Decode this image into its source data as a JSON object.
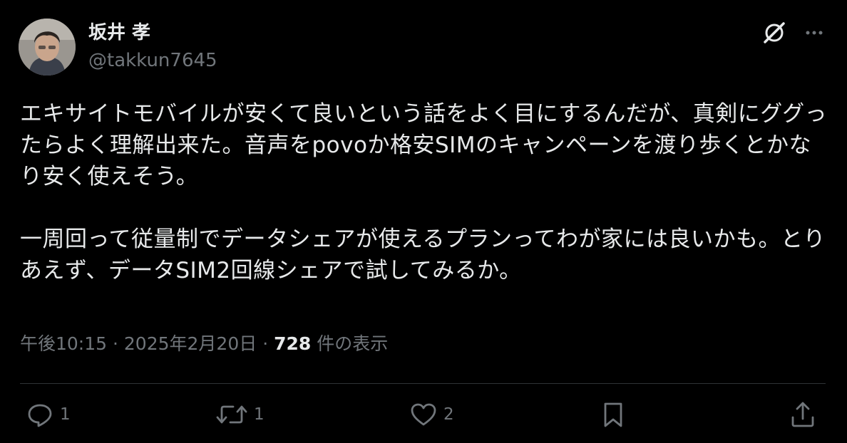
{
  "author": {
    "display_name": "坂井 孝",
    "handle": "@takkun7645"
  },
  "post": {
    "text": "エキサイトモバイルが安くて良いという話をよく目にするんだが、真剣にググったらよく理解出来た。音声をpovoか格安SIMのキャンペーンを渡り歩くとかなり安く使えそう。\n\n一周回って従量制でデータシェアが使えるプランってわが家には良いかも。とりあえず、データSIM2回線シェアで試してみるか。"
  },
  "meta": {
    "time": "午後10:15",
    "separator": "·",
    "date": "2025年2月20日",
    "views_count": "728",
    "views_label": "件の表示"
  },
  "actions": {
    "reply_count": "1",
    "repost_count": "1",
    "like_count": "2"
  },
  "icons": {
    "header": [
      "grok-icon",
      "more-icon"
    ],
    "actions": [
      "reply-icon",
      "repost-icon",
      "like-icon",
      "bookmark-icon",
      "share-icon"
    ]
  },
  "colors": {
    "background": "#000000",
    "text_primary": "#e7e9ea",
    "text_secondary": "#71767b",
    "divider": "#2f3336"
  }
}
